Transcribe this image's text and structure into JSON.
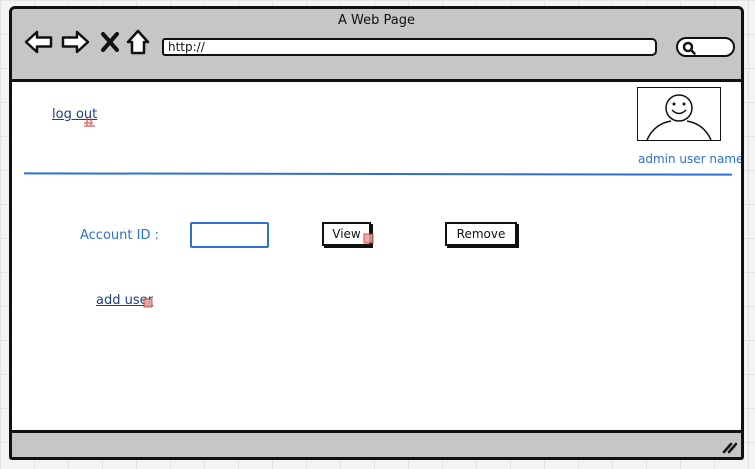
{
  "window": {
    "title": "A Web Page"
  },
  "toolbar": {
    "back_icon": "back-arrow-icon",
    "forward_icon": "forward-arrow-icon",
    "stop_icon": "close-x-icon",
    "home_icon": "home-icon",
    "url": "http://",
    "search_icon": "search-icon"
  },
  "header": {
    "logout_label": "log out",
    "avatar_icon": "smiley-face-icon",
    "user_name": "admin user name"
  },
  "form": {
    "account_id_label": "Account ID :",
    "account_id_value": "",
    "view_label": "View",
    "remove_label": "Remove"
  },
  "links": {
    "add_user_label": "add user"
  },
  "colors": {
    "accent": "#2c6fd6",
    "link": "#1a3f8a",
    "chrome": "#c6c6c6"
  }
}
